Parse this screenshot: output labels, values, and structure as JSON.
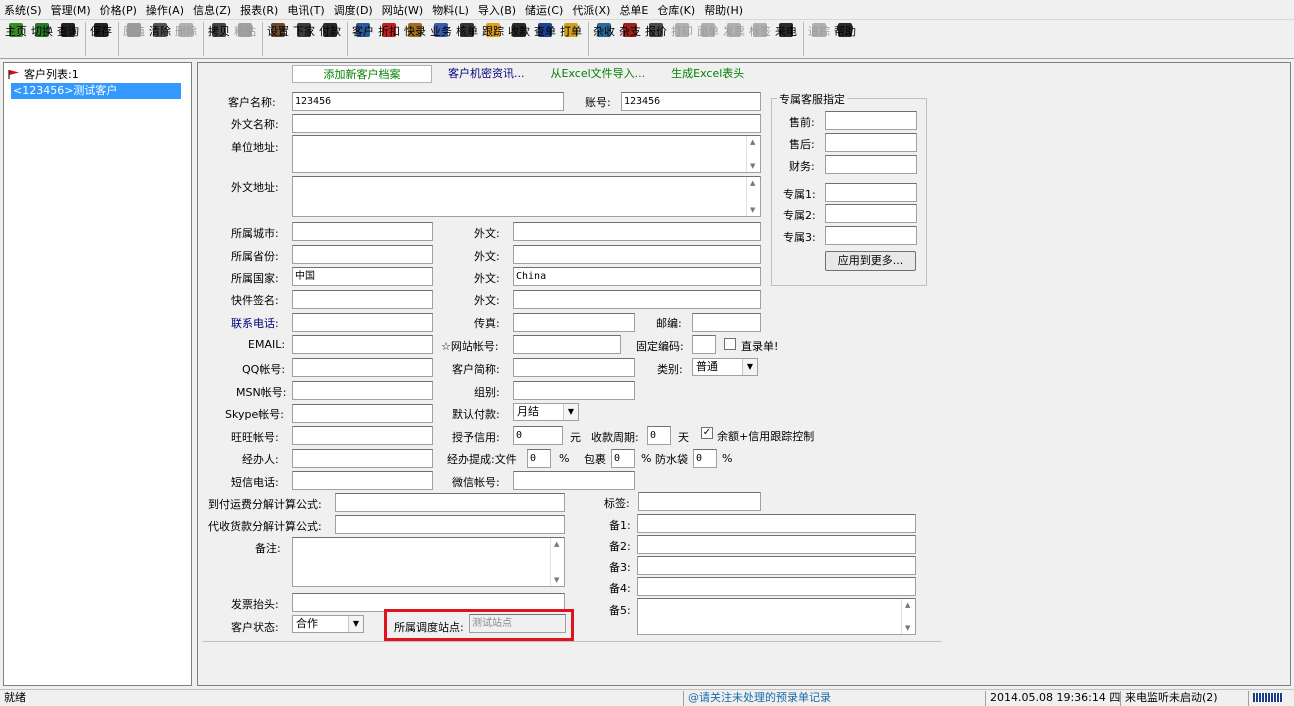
{
  "menu": [
    "系统(S)",
    "管理(M)",
    "价格(P)",
    "操作(A)",
    "信息(Z)",
    "报表(R)",
    "电讯(T)",
    "调度(D)",
    "网站(W)",
    "物料(L)",
    "导入(B)",
    "储运(C)",
    "代派(X)",
    "总单E",
    "仓库(K)",
    "帮助(H)"
  ],
  "toolbar": [
    {
      "label": "主页",
      "color": "#3a8a2a",
      "disabled": false,
      "sep_after": false
    },
    {
      "label": "切换",
      "color": "#2a7a2a",
      "disabled": false,
      "sep_after": false
    },
    {
      "label": "查询",
      "color": "#222222",
      "disabled": false,
      "sep_after": true
    },
    {
      "label": "保存",
      "color": "#222222",
      "disabled": false,
      "sep_after": true
    },
    {
      "label": "原值",
      "color": "#9a9a9a",
      "disabled": true,
      "sep_after": false
    },
    {
      "label": "清除",
      "color": "#555555",
      "disabled": false,
      "sep_after": false
    },
    {
      "label": "删除",
      "color": "#b0b0b0",
      "disabled": true,
      "sep_after": true
    },
    {
      "label": "拷贝",
      "color": "#444444",
      "disabled": false,
      "sep_after": false
    },
    {
      "label": "粘贴",
      "color": "#a0a0a0",
      "disabled": true,
      "sep_after": true
    },
    {
      "label": "设置",
      "color": "#6a4a2a",
      "disabled": false,
      "sep_after": false
    },
    {
      "label": "下家",
      "color": "#3a3a3a",
      "disabled": false,
      "sep_after": false
    },
    {
      "label": "付款",
      "color": "#2a2a2a",
      "disabled": false,
      "sep_after": true
    },
    {
      "label": "客户",
      "color": "#2a5a9a",
      "disabled": false,
      "sep_after": false
    },
    {
      "label": "折扣",
      "color": "#c02020",
      "disabled": false,
      "sep_after": false
    },
    {
      "label": "快录",
      "color": "#a07020",
      "disabled": false,
      "sep_after": false
    },
    {
      "label": "业务",
      "color": "#3a5aaa",
      "disabled": false,
      "sep_after": false
    },
    {
      "label": "核单",
      "color": "#333333",
      "disabled": false,
      "sep_after": false
    },
    {
      "label": "跟踪",
      "color": "#e0a020",
      "disabled": false,
      "sep_after": false
    },
    {
      "label": "收款",
      "color": "#2a2a2a",
      "disabled": false,
      "sep_after": false
    },
    {
      "label": "查单",
      "color": "#204090",
      "disabled": false,
      "sep_after": false
    },
    {
      "label": "打单",
      "color": "#d0a020",
      "disabled": false,
      "sep_after": true
    },
    {
      "label": "杂收",
      "color": "#2a6a9a",
      "disabled": false,
      "sep_after": false
    },
    {
      "label": "杂支",
      "color": "#a02020",
      "disabled": false,
      "sep_after": false
    },
    {
      "label": "报价",
      "color": "#4a4a4a",
      "disabled": false,
      "sep_after": false
    },
    {
      "label": "打印",
      "color": "#b0b0b0",
      "disabled": true,
      "sep_after": false
    },
    {
      "label": "面单",
      "color": "#b0b0b0",
      "disabled": true,
      "sep_after": false
    },
    {
      "label": "发票",
      "color": "#b0b0b0",
      "disabled": true,
      "sep_after": false
    },
    {
      "label": "标签",
      "color": "#b0b0b0",
      "disabled": true,
      "sep_after": false
    },
    {
      "label": "来电",
      "color": "#2a2a2a",
      "disabled": false,
      "sep_after": true
    },
    {
      "label": "追踪",
      "color": "#b0b0b0",
      "disabled": true,
      "sep_after": false
    },
    {
      "label": "帮助",
      "color": "#2a2a2a",
      "disabled": false,
      "sep_after": false
    }
  ],
  "left": {
    "title": "客户列表:1",
    "selected_item": "<123456>测试客户"
  },
  "tabs": [
    "添加新客户档案",
    "客户机密资讯...",
    "从Excel文件导入...",
    "生成Excel表头"
  ],
  "form": {
    "customer_name_label": "客户名称:",
    "customer_name": "123456",
    "account_label": "账号:",
    "account": "123456",
    "foreign_name_label": "外文名称:",
    "address_label": "单位地址:",
    "foreign_address_label": "外文地址:",
    "city_label": "所属城市:",
    "province_label": "所属省份:",
    "country_label": "所属国家:",
    "country": "中国",
    "quick_sign_label": "快件签名:",
    "foreign_label": "外文:",
    "country_foreign": "China",
    "phone_label": "联系电话:",
    "fax_label": "传真:",
    "zip_label": "邮编:",
    "email_label": "EMAIL:",
    "site_account_label": "☆网站帐号:",
    "fixed_code_label": "固定编码:",
    "direct_entry_label": "直录单!",
    "qq_label": "QQ帐号:",
    "short_name_label": "客户简称:",
    "category_label": "类别:",
    "category": "普通",
    "msn_label": "MSN帐号:",
    "group_label": "组别:",
    "skype_label": "Skype帐号:",
    "default_pay_label": "默认付款:",
    "default_pay": "月结",
    "wangwang_label": "旺旺帐号:",
    "credit_label": "授予信用:",
    "credit": "0",
    "yuan": "元",
    "cycle_label": "收款周期:",
    "cycle": "0",
    "day": "天",
    "balance_label": "余额+信用跟踪控制",
    "agent_label": "经办人:",
    "commission_label": "经办提成:文件",
    "commission_file": "0",
    "pct": "%",
    "package_label": "包裹",
    "package": "0",
    "bag_label": "防水袋",
    "bag": "0",
    "sms_label": "短信电话:",
    "wechat_label": "微信帐号:",
    "freight_formula_label": "到付运费分解计算公式:",
    "collect_formula_label": "代收货款分解计算公式:",
    "tag_label": "标签:",
    "note_label": "备注:",
    "remark1_label": "备1:",
    "remark2_label": "备2:",
    "remark3_label": "备3:",
    "remark4_label": "备4:",
    "remark5_label": "备5:",
    "invoice_label": "发票抬头:",
    "status_label": "客户状态:",
    "status": "合作",
    "station_label": "所属调度站点:",
    "station": "测试站点"
  },
  "service": {
    "title": "专属客服指定",
    "presale": "售前:",
    "aftersale": "售后:",
    "finance": "财务:",
    "p1": "专属1:",
    "p2": "专属2:",
    "p3": "专属3:",
    "apply_button": "应用到更多..."
  },
  "status": {
    "ready": "就绪",
    "notice": "@请关注未处理的预录单记录",
    "datetime": "2014.05.08 19:36:14 四",
    "listen": "来电监听未启动(2)"
  }
}
